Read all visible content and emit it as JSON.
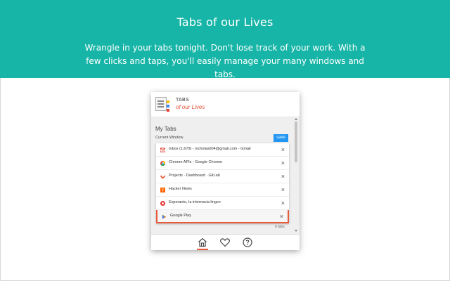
{
  "banner": {
    "title": "Tabs of our Lives",
    "description": "Wrangle in your tabs tonight. Don't lose track of your work. With a few clicks and taps, you'll easily manage your many windows and tabs."
  },
  "popup": {
    "brand": {
      "top": "TABS",
      "bottom": "of our Lives"
    },
    "section_title": "My Tabs",
    "window_label": "Current Window",
    "save_label": "save",
    "tabs": [
      {
        "title": "Inbox (1,679) - nicholas604@gmail.com - Gmail",
        "icon": "gmail-icon",
        "color": "#d93025"
      },
      {
        "title": "Chrome APIs - Google Chrome",
        "icon": "chrome-icon",
        "color": "#4285f4"
      },
      {
        "title": "Projects · Dashboard · GitLab",
        "icon": "gitlab-icon",
        "color": "#e24329"
      },
      {
        "title": "Hacker News",
        "icon": "hacker-news-icon",
        "color": "#ff6600"
      },
      {
        "title": "Esperanto, la internacia lingvo",
        "icon": "esperanto-icon",
        "color": "#e53935"
      },
      {
        "title": "Google Play",
        "icon": "google-play-icon",
        "color": "#34a853"
      }
    ],
    "tab_count": "6 tabs",
    "footer": [
      "home-icon",
      "heart-icon",
      "help-icon"
    ],
    "accent_color": "#e55b3c",
    "save_color": "#2196f3"
  },
  "colors": {
    "banner": "#17b5a7"
  }
}
